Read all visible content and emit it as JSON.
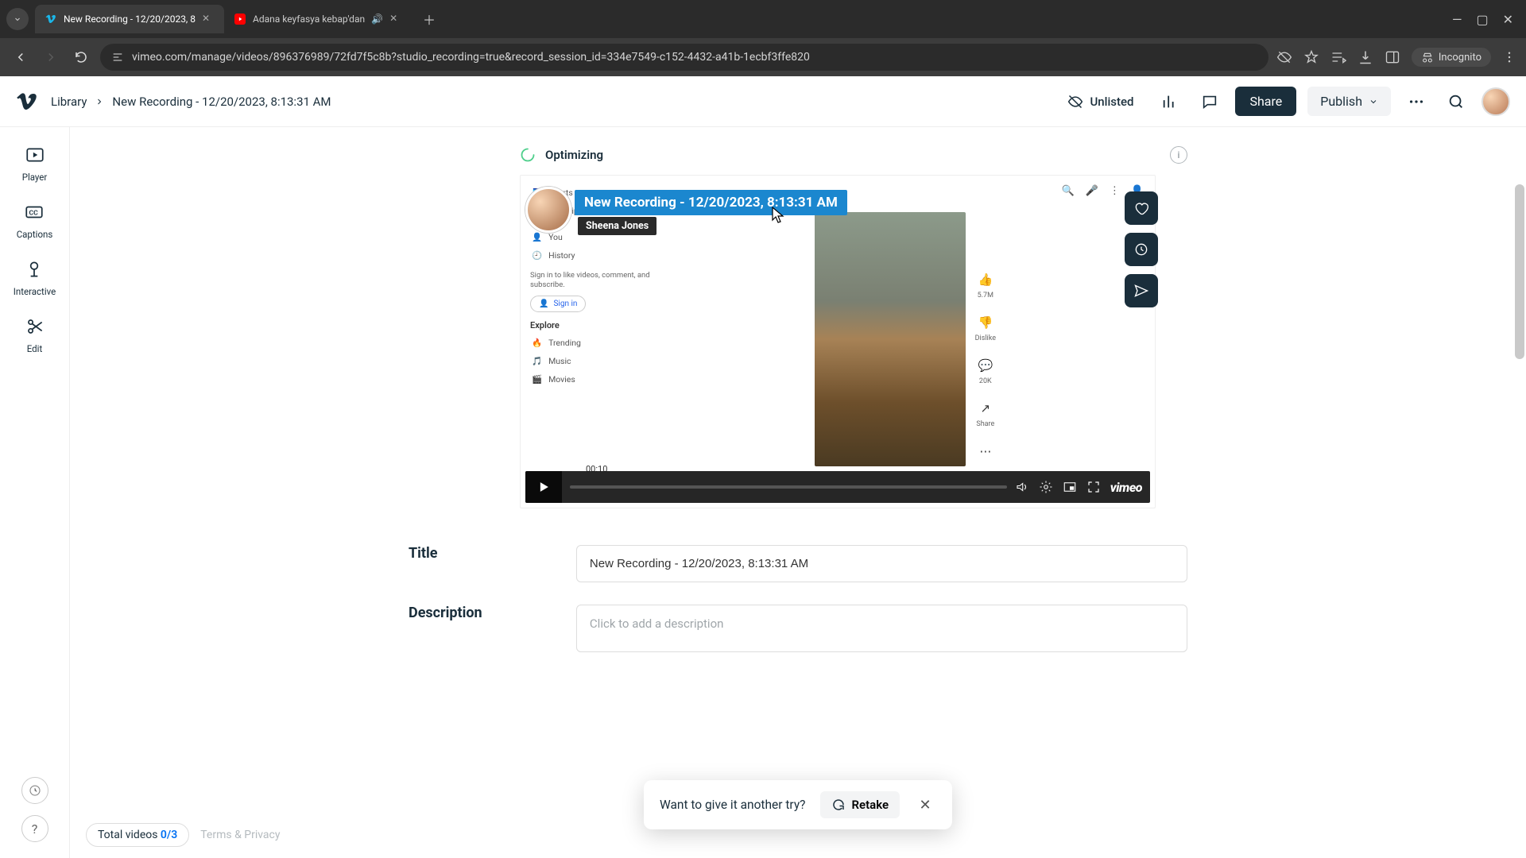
{
  "browser": {
    "tabs": [
      {
        "title": "New Recording - 12/20/2023, 8",
        "active": true
      },
      {
        "title": "Adana keyfasya kebap'dan",
        "active": false
      }
    ],
    "url": "vimeo.com/manage/videos/896376989/72fd7f5c8b?studio_recording=true&record_session_id=334e7549-c152-4432-a41b-1ecbf3ffe820",
    "incognito_label": "Incognito"
  },
  "header": {
    "breadcrumb_root": "Library",
    "breadcrumb_current": "New Recording - 12/20/2023, 8:13:31 AM",
    "privacy": "Unlisted",
    "share": "Share",
    "publish": "Publish"
  },
  "rail": {
    "items": [
      "Player",
      "Captions",
      "Interactive",
      "Edit"
    ]
  },
  "optimizing": {
    "label": "Optimizing"
  },
  "overlay": {
    "title": "New Recording - 12/20/2023, 8:13:31 AM",
    "author": "Sheena Jones"
  },
  "player": {
    "timecode": "00:10",
    "brand": "vimeo"
  },
  "youtube_preview": {
    "sidebar": {
      "shorts": "Shorts",
      "subscriptions": "Subscriptions",
      "you": "You",
      "history": "History",
      "signin_hint": "Sign in to like videos, comment, and subscribe.",
      "signin": "Sign in",
      "explore": "Explore",
      "trending": "Trending",
      "music": "Music",
      "movies": "Movies"
    },
    "actions": {
      "likes": "5.7M",
      "dislike": "Dislike",
      "comments": "20K",
      "share": "Share"
    }
  },
  "form": {
    "title_label": "Title",
    "title_value": "New Recording - 12/20/2023, 8:13:31 AM",
    "desc_label": "Description",
    "desc_placeholder": "Click to add a description"
  },
  "toast": {
    "text": "Want to give it another try?",
    "retake": "Retake"
  },
  "footer": {
    "total_label": "Total videos ",
    "fraction": "0/3",
    "terms": "Terms & Privacy"
  }
}
